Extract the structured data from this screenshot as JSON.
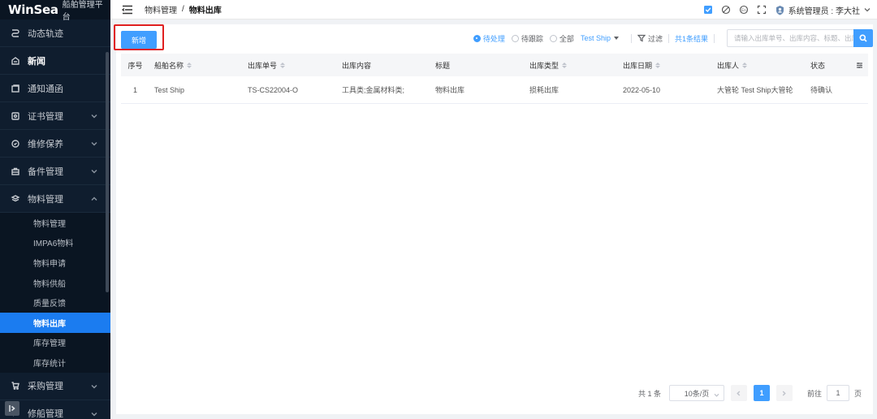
{
  "app": {
    "logo": "WinSea",
    "subtitle": "船舶管理平台"
  },
  "sidebar": {
    "items": [
      {
        "label": "动态轨迹",
        "icon": "route-icon"
      },
      {
        "label": "新闻",
        "icon": "news-icon"
      },
      {
        "label": "通知通函",
        "icon": "notice-icon"
      },
      {
        "label": "证书管理",
        "icon": "certificate-icon"
      },
      {
        "label": "维修保养",
        "icon": "maintenance-icon"
      },
      {
        "label": "备件管理",
        "icon": "briefcase-icon"
      },
      {
        "label": "物料管理",
        "icon": "layers-icon"
      }
    ],
    "submenu": [
      {
        "label": "物料管理"
      },
      {
        "label": "IMPA6物料"
      },
      {
        "label": "物料申请"
      },
      {
        "label": "物料供船"
      },
      {
        "label": "质量反馈"
      },
      {
        "label": "物料出库"
      },
      {
        "label": "库存管理"
      },
      {
        "label": "库存统计"
      }
    ],
    "bottom_items": [
      {
        "label": "采购管理",
        "icon": "cart-icon"
      },
      {
        "label": "修船管理",
        "icon": "repair-icon"
      }
    ]
  },
  "header": {
    "breadcrumb_parent": "物料管理",
    "breadcrumb_sep": "/",
    "breadcrumb_current": "物料出库",
    "user": "系统管理员 : 李大社"
  },
  "toolbar": {
    "add_label": "新增",
    "radio_pending": "待处理",
    "radio_tracking": "待跟踪",
    "radio_all": "全部",
    "ship_select": "Test Ship",
    "filter_label": "过滤",
    "total_label": "共1条结果",
    "search_placeholder": "请输入出库单号、出库内容、标题、出库人"
  },
  "table": {
    "headers": [
      "序号",
      "船舶名称",
      "出库单号",
      "出库内容",
      "标题",
      "出库类型",
      "出库日期",
      "出库人",
      "状态"
    ],
    "rows": [
      [
        "1",
        "Test Ship",
        "TS-CS22004-O",
        "工具类;金属材料类;",
        "物料出库",
        "损耗出库",
        "2022-05-10",
        "大管轮 Test Ship大管轮",
        "待确认"
      ]
    ]
  },
  "pagination": {
    "total": "共 1 条",
    "page_size": "10条/页",
    "current_page": "1",
    "goto_label": "前往",
    "goto_value": "1",
    "goto_suffix": "页"
  },
  "colors": {
    "accent": "#409eff",
    "sidebar_bg": "#0f1d2e",
    "active_item": "#1b7cf0",
    "highlight_border": "#e02020"
  }
}
